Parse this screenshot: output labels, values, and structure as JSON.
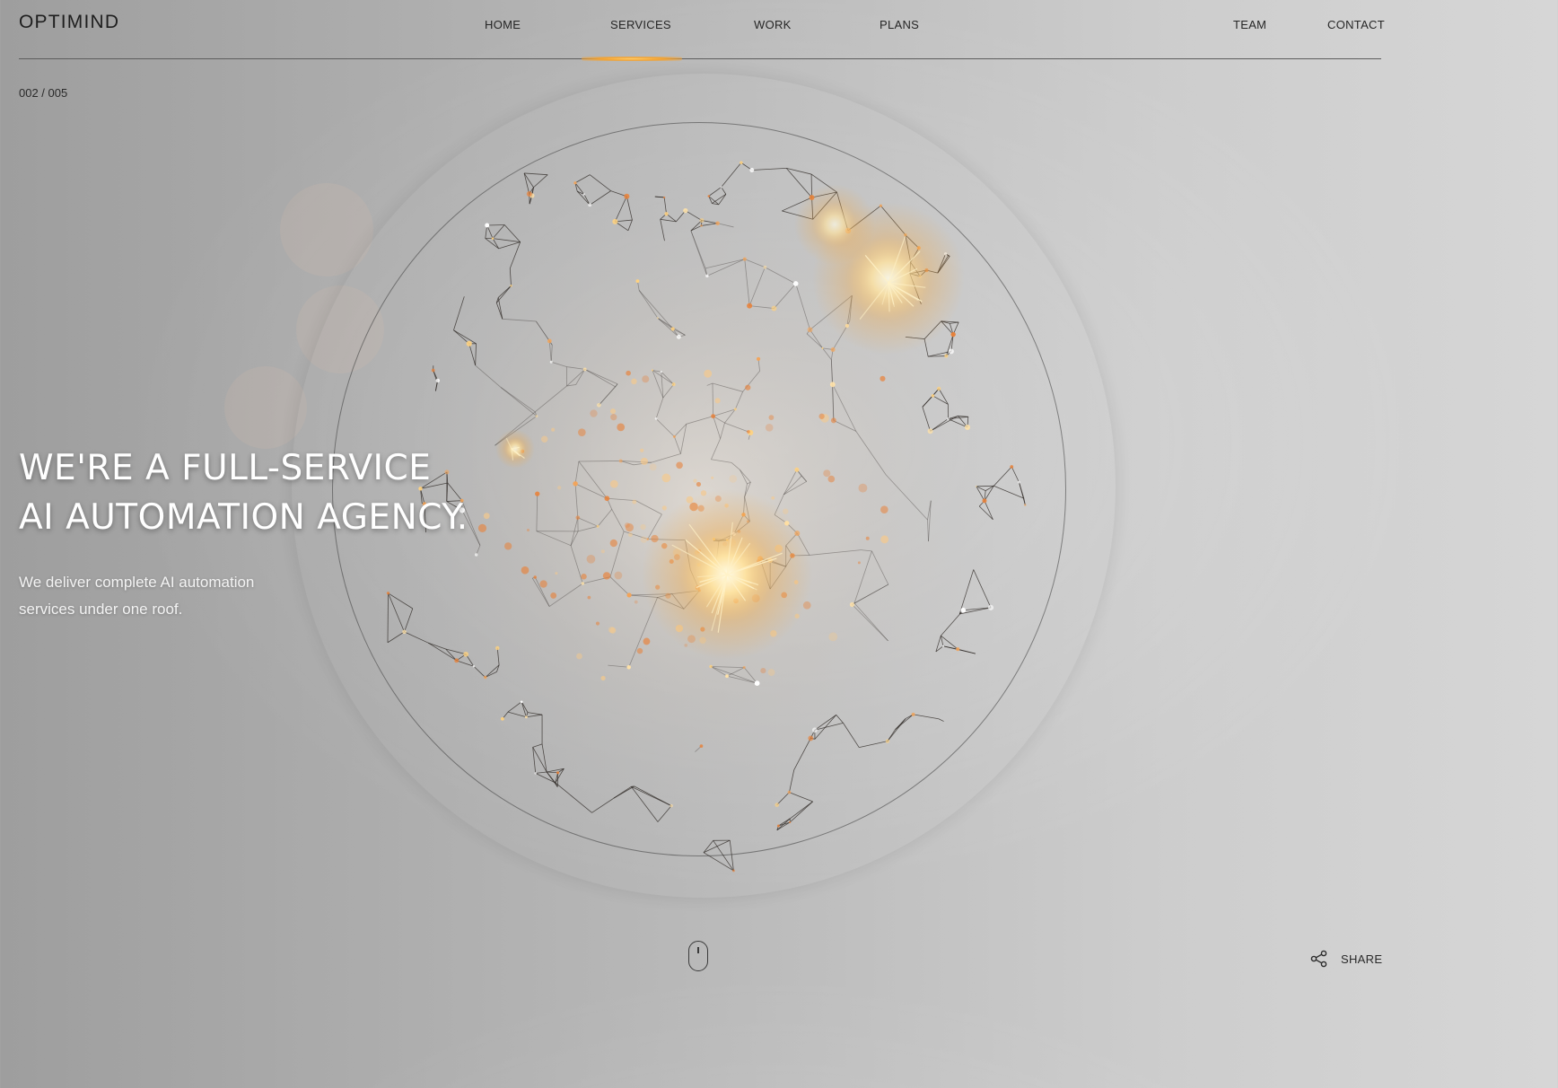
{
  "brand": {
    "logo": "OPTIMIND"
  },
  "nav": {
    "items": [
      {
        "label": "HOME"
      },
      {
        "label": "SERVICES",
        "active": true
      },
      {
        "label": "WORK"
      },
      {
        "label": "PLANS"
      },
      {
        "label": "TEAM"
      },
      {
        "label": "CONTACT"
      }
    ],
    "active_indicator_color": "#f2a232"
  },
  "slide": {
    "counter": "002 / 005"
  },
  "hero": {
    "title_line1": "WE'RE A FULL-SERVICE",
    "title_line2": "AI AUTOMATION AGENCY.",
    "subtitle_line1": "We deliver complete AI automation",
    "subtitle_line2": "services under one roof."
  },
  "footer": {
    "scroll_icon": "mouse-scroll-icon",
    "share_icon": "share-icon",
    "share_label": "SHARE"
  },
  "colors": {
    "background": "#b9b9b9",
    "text_light": "#ffffff",
    "text_dark": "#1e1e1e",
    "glow": "#ffcf6e",
    "particle": "#e8823a",
    "mesh": "#2b2622"
  }
}
